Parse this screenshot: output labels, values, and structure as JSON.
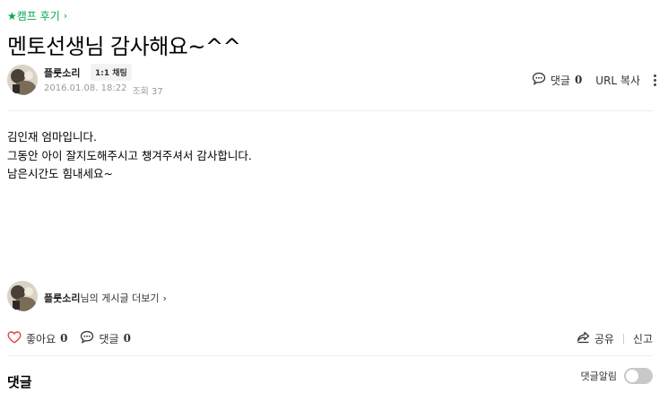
{
  "post": {
    "board_label": "★캠프 후기",
    "title": "멘토선생님 감사해요~^^",
    "author": "플룻소리",
    "chat_badge": "1:1 채팅",
    "date": "2016.01.08. 18:22",
    "views": "조회 37",
    "body_lines": [
      "김인재 엄마입니다.",
      "그동안 아이 잘지도해주시고 챙겨주셔서 감사합니다.",
      "남은시간도 힘내세요~"
    ]
  },
  "top_actions": {
    "comment_label": "댓글",
    "comment_count": "0",
    "url_copy": "URL 복사"
  },
  "profile_link": {
    "author": "플룻소리",
    "suffix": "님의 게시글 더보기"
  },
  "bottom_bar": {
    "like_label": "좋아요",
    "like_count": "0",
    "comment_label": "댓글",
    "comment_count": "0",
    "share_label": "공유",
    "report_label": "신고"
  },
  "comments": {
    "heading": "댓글",
    "alarm_label": "댓글알림"
  },
  "colors": {
    "accent_green": "#03a94d",
    "like_red": "#e0464e"
  }
}
